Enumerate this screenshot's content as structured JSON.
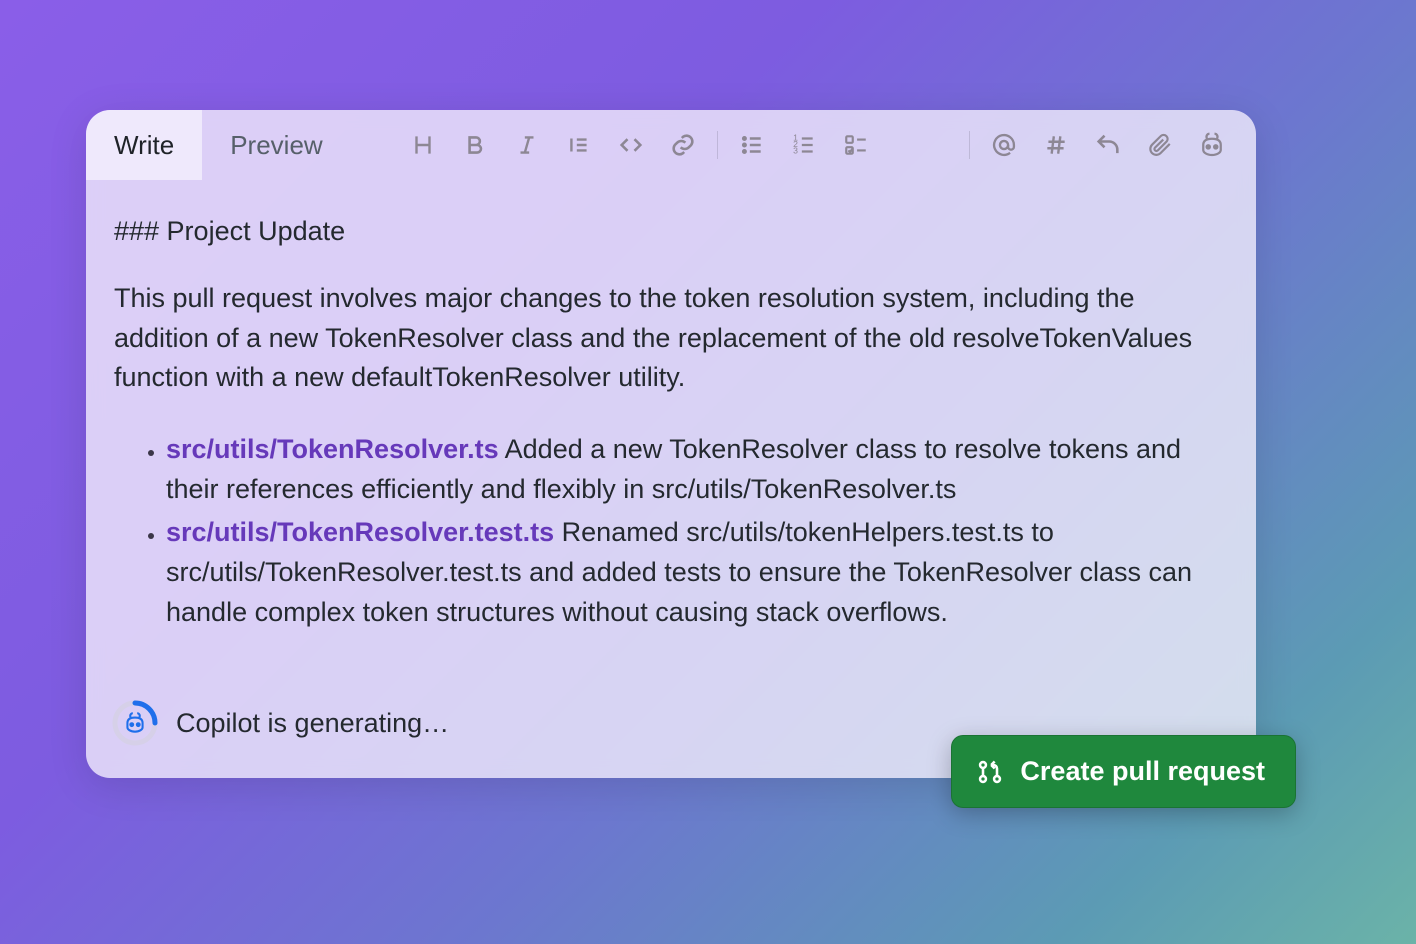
{
  "tabs": {
    "write": "Write",
    "preview": "Preview"
  },
  "doc": {
    "heading": "### Project Update",
    "paragraph": "This pull request involves major changes to the token resolution system, including the addition of a new TokenResolver class and the replacement of the old resolveTokenValues function with a new defaultTokenResolver utility.",
    "bullets": [
      {
        "file": "src/utils/TokenResolver.ts",
        "text": " Added a new TokenResolver class to resolve tokens and their references efficiently and flexibly in src/utils/TokenResolver.ts"
      },
      {
        "file": "src/utils/TokenResolver.test.ts",
        "text": " Renamed src/utils/tokenHelpers.test.ts to src/utils/TokenResolver.test.ts and added tests to ensure the TokenResolver class can handle complex token structures without causing stack overflows."
      }
    ]
  },
  "status": {
    "text": "Copilot is generating…"
  },
  "cta": {
    "label": "Create pull request"
  },
  "toolbar_icons": {
    "heading": "heading-icon",
    "bold": "bold-icon",
    "italic": "italic-icon",
    "quote": "quote-icon",
    "code": "code-icon",
    "link": "link-icon",
    "ul": "bulleted-list-icon",
    "ol": "numbered-list-icon",
    "task": "task-list-icon",
    "mention": "mention-icon",
    "hash": "hash-icon",
    "reply": "reply-icon",
    "attach": "attach-icon",
    "copilot": "copilot-icon"
  }
}
